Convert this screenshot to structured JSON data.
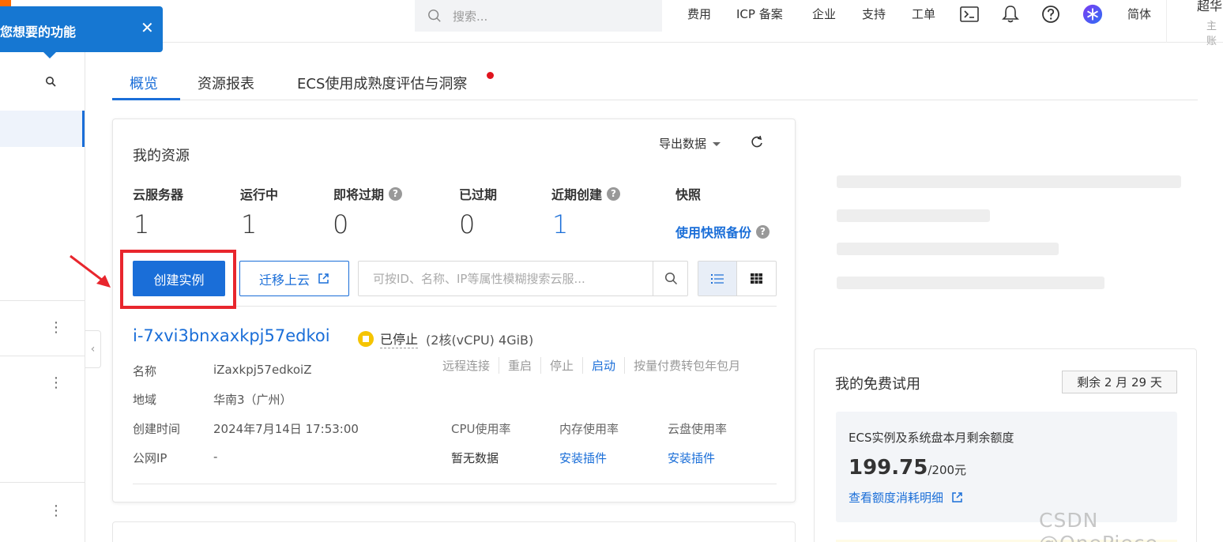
{
  "tooltip": {
    "text": "您想要的功能",
    "close": "✕"
  },
  "topbar": {
    "search_placeholder": "搜索...",
    "nav": [
      "费用",
      "ICP 备案",
      "企业",
      "支持",
      "工单"
    ],
    "lang": "简体",
    "account_name": "超华",
    "account_role": "主账"
  },
  "tabs": [
    {
      "label": "概览",
      "active": true
    },
    {
      "label": "资源报表",
      "active": false
    },
    {
      "label": "ECS使用成熟度评估与洞察",
      "active": false,
      "has_dot": true
    }
  ],
  "resources": {
    "title": "我的资源",
    "export_label": "导出数据",
    "stats": [
      {
        "label": "云服务器",
        "value": "1",
        "help": false
      },
      {
        "label": "运行中",
        "value": "1",
        "help": false
      },
      {
        "label": "即将过期",
        "value": "0",
        "help": true
      },
      {
        "label": "已过期",
        "value": "0",
        "help": false
      },
      {
        "label": "近期创建",
        "value": "1",
        "help": true
      }
    ],
    "snapshot": {
      "label": "快照",
      "link": "使用快照备份"
    },
    "create_button": "创建实例",
    "migrate_button": "迁移上云",
    "search_placeholder": "可按ID、名称、IP等属性模糊搜索云服..."
  },
  "instance": {
    "id": "i-7xvi3bnxaxkpj57edkoi",
    "status": "已停止",
    "spec": "(2核(vCPU) 4GiB)",
    "actions": [
      {
        "label": "远程连接",
        "enabled": false
      },
      {
        "label": "重启",
        "enabled": false
      },
      {
        "label": "停止",
        "enabled": false
      },
      {
        "label": "启动",
        "enabled": true
      },
      {
        "label": "按量付费转包年包月",
        "enabled": false
      }
    ],
    "fields": [
      {
        "label": "名称",
        "value": "iZaxkpj57edkoiZ"
      },
      {
        "label": "地域",
        "value": "华南3（广州）"
      },
      {
        "label": "创建时间",
        "value": "2024年7月14日 17:53:00"
      },
      {
        "label": "公网IP",
        "value": "-"
      }
    ],
    "usage": [
      {
        "label": "CPU使用率",
        "value": "暂无数据",
        "link": false
      },
      {
        "label": "内存使用率",
        "value": "安装插件",
        "link": true
      },
      {
        "label": "云盘使用率",
        "value": "安装插件",
        "link": true
      }
    ]
  },
  "trial": {
    "title": "我的免费试用",
    "remaining": "剩余 2 月 29 天",
    "quota_title": "ECS实例及系统盘本月剩余额度",
    "amount": "199.75",
    "total": "/200元",
    "detail_link": "查看额度消耗明细"
  },
  "watermark": "CSDN @OnePiece",
  "colors": {
    "primary": "#1a6ed8",
    "highlight": "#e8262d",
    "status_stopped": "#f5c400",
    "tooltip_bg": "#1677d2"
  }
}
